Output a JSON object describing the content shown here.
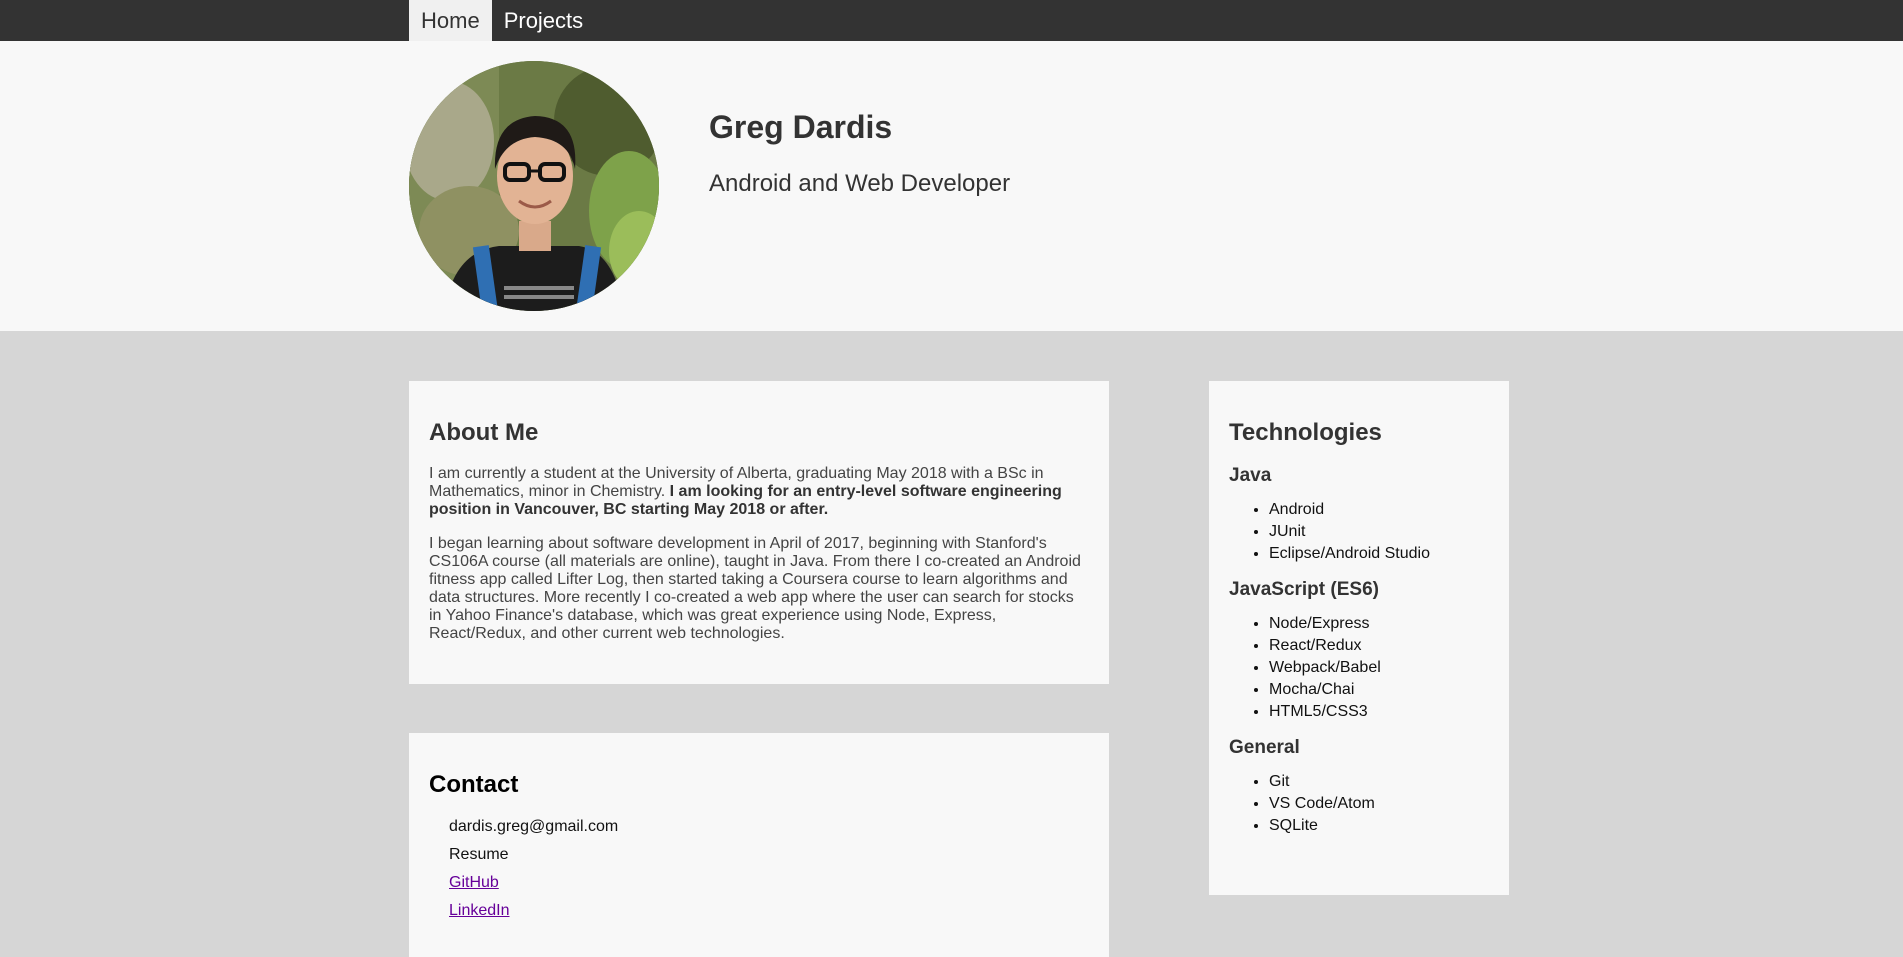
{
  "nav": {
    "items": [
      {
        "label": "Home",
        "active": true
      },
      {
        "label": "Projects",
        "active": false
      }
    ]
  },
  "header": {
    "name": "Greg Dardis",
    "tagline": "Android and Web Developer"
  },
  "about": {
    "title": "About Me",
    "para1_text": "I am currently a student at the University of Alberta, graduating May 2018 with a BSc in Mathematics, minor in Chemistry. ",
    "para1_bold": "I am looking for an entry-level software engineering position in Vancouver, BC starting May 2018 or after.",
    "para2": "I began learning about software development in April of 2017, beginning with Stanford's CS106A course (all materials are online), taught in Java. From there I co-created an Android fitness app called Lifter Log, then started taking a Coursera course to learn algorithms and data structures. More recently I co-created a web app where the user can search for stocks in Yahoo Finance's database, which was great experience using Node, Express, React/Redux, and other current web technologies."
  },
  "contact": {
    "title": "Contact",
    "email": "dardis.greg@gmail.com",
    "resume": "Resume",
    "github": "GitHub",
    "linkedin": "LinkedIn"
  },
  "tech": {
    "title": "Technologies",
    "groups": [
      {
        "name": "Java",
        "items": [
          "Android",
          "JUnit",
          "Eclipse/Android Studio"
        ]
      },
      {
        "name": "JavaScript (ES6)",
        "items": [
          "Node/Express",
          "React/Redux",
          "Webpack/Babel",
          "Mocha/Chai",
          "HTML5/CSS3"
        ]
      },
      {
        "name": "General",
        "items": [
          "Git",
          "VS Code/Atom",
          "SQLite"
        ]
      }
    ]
  },
  "colors": {
    "nav_bg": "#333333",
    "page_bg": "#d6d6d6",
    "card_bg": "#f8f8f8",
    "link_visited": "#660099"
  }
}
